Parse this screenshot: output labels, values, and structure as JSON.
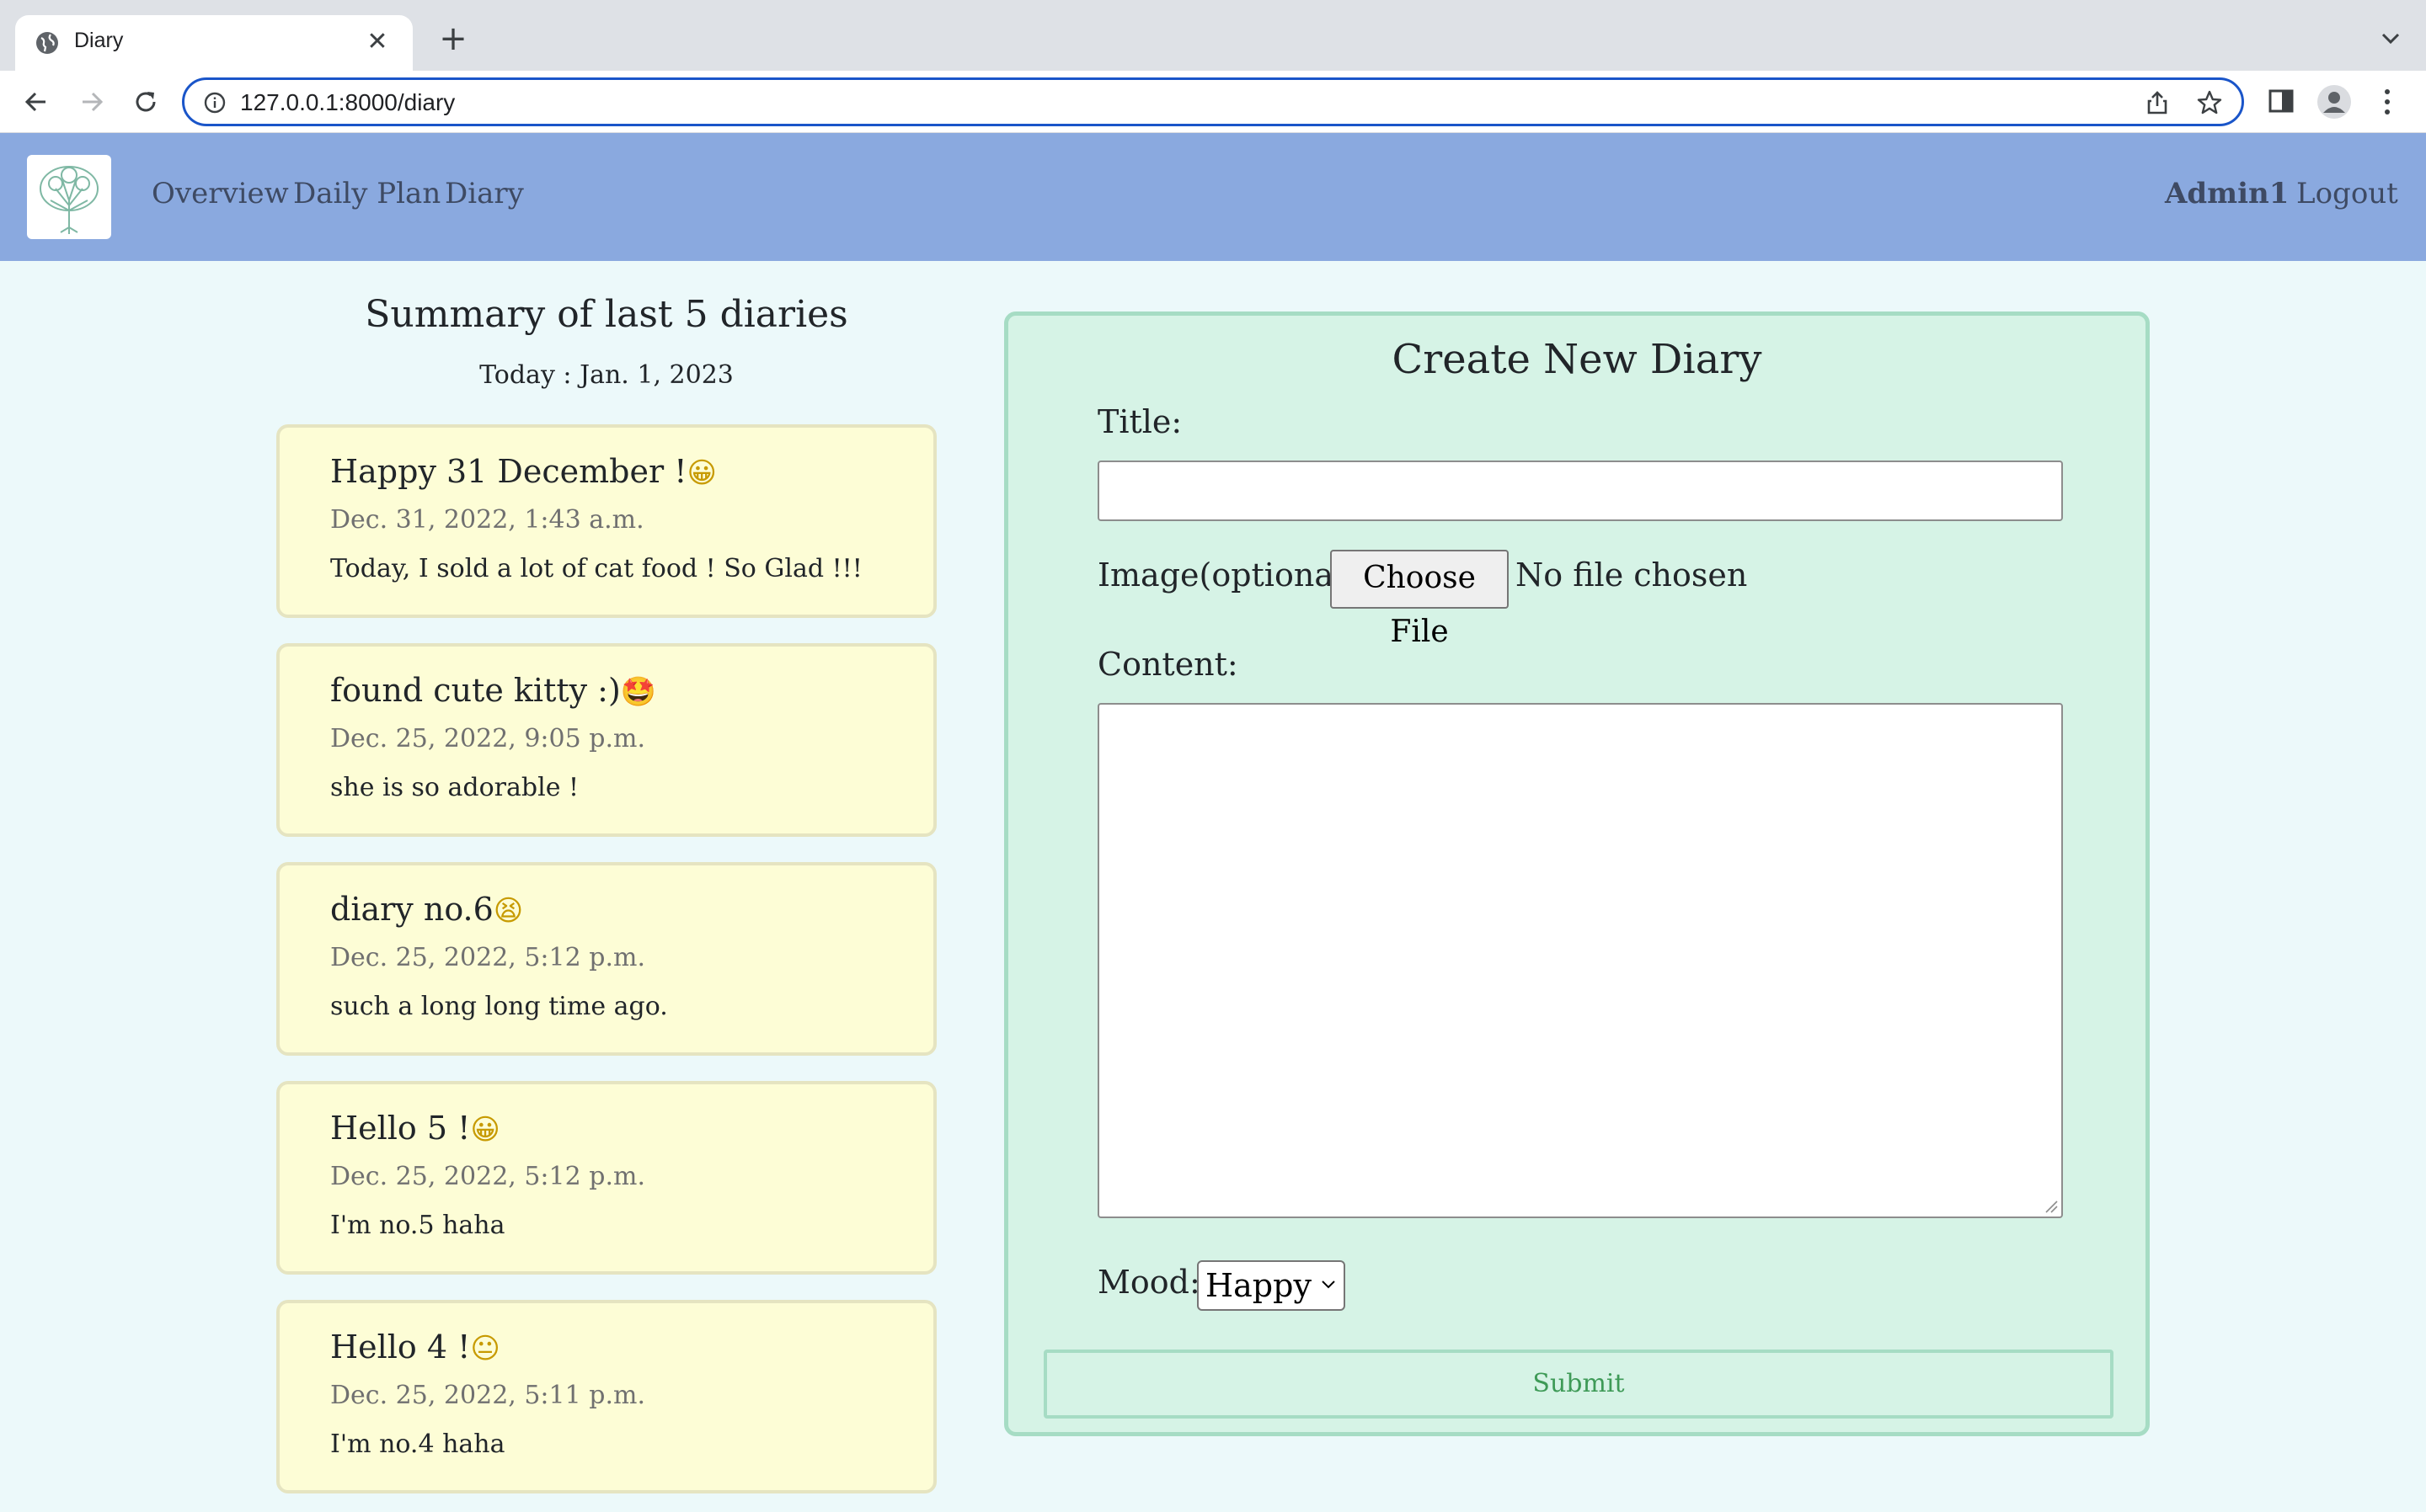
{
  "browser": {
    "tab_title": "Diary",
    "url": "127.0.0.1:8000/diary",
    "new_tab_symbol": "+",
    "close_symbol": "✕"
  },
  "nav": {
    "links": [
      "Overview",
      "Daily Plan",
      "Diary"
    ],
    "user": "Admin1",
    "logout": "Logout",
    "logo_icon": "tree-icon"
  },
  "summary": {
    "title": "Summary of last 5 diaries",
    "today": "Today : Jan. 1, 2023",
    "entries": [
      {
        "title": "Happy 31 December !",
        "emoji": "😀",
        "date": "Dec. 31, 2022, 1:43 a.m.",
        "text": "Today, I sold a lot of cat food ! So Glad !!!"
      },
      {
        "title": "found cute kitty :)",
        "emoji": "🤩",
        "date": "Dec. 25, 2022, 9:05 p.m.",
        "text": "she is so adorable !"
      },
      {
        "title": "diary no.6",
        "emoji": "😫",
        "date": "Dec. 25, 2022, 5:12 p.m.",
        "text": "such a long long time ago."
      },
      {
        "title": "Hello 5 !",
        "emoji": "😀",
        "date": "Dec. 25, 2022, 5:12 p.m.",
        "text": "I'm no.5 haha"
      },
      {
        "title": "Hello 4 !",
        "emoji": "😐",
        "date": "Dec. 25, 2022, 5:11 p.m.",
        "text": "I'm no.4 haha"
      }
    ]
  },
  "form": {
    "title": "Create New Diary",
    "title_label": "Title:",
    "title_value": "",
    "image_label": "Image(optional):",
    "choose_file": "Choose File",
    "no_file": "No file chosen",
    "content_label": "Content:",
    "content_value": "",
    "mood_label": "Mood:",
    "mood_value": "Happy",
    "submit": "Submit"
  },
  "colors": {
    "nav_bg": "#8aa9df",
    "page_bg": "#ecf9fa",
    "card_bg": "#fdfdd6",
    "form_bg": "#d6f3e6",
    "submit_text": "#3e9a57"
  }
}
